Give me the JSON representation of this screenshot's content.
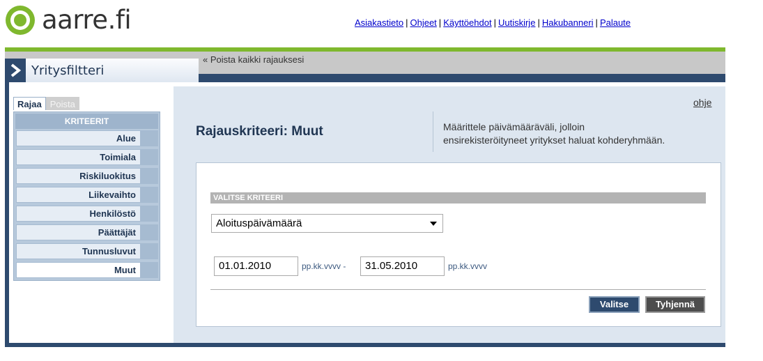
{
  "brand": {
    "name": "aarre.fi",
    "color": "#7fb82e"
  },
  "top_links": [
    "Asiakastieto",
    "Ohjeet",
    "Käyttöehdot",
    "Uutiskirje",
    "Hakubanneri",
    "Palaute"
  ],
  "top_link_separator": "|",
  "main_tab": {
    "title": "Yritysfiltteri",
    "icon": "chevron-right-icon"
  },
  "remove_all": "« Poista kaikki rajauksesi",
  "sidebar": {
    "tabs": [
      {
        "label": "Rajaa",
        "active": true
      },
      {
        "label": "Poista",
        "active": false
      }
    ],
    "header": "KRITEERIT",
    "items": [
      {
        "label": "Alue"
      },
      {
        "label": "Toimiala"
      },
      {
        "label": "Riskiluokitus"
      },
      {
        "label": "Liikevaihto"
      },
      {
        "label": "Henkilöstö"
      },
      {
        "label": "Päättäjät"
      },
      {
        "label": "Tunnusluvut"
      },
      {
        "label": "Muut",
        "selected": true
      }
    ]
  },
  "content": {
    "help": "ohje",
    "title": "Rajauskriteeri: Muut",
    "description_line1": "Määrittele päivämääräväli, jolloin",
    "description_line2": "ensirekisteröityneet yritykset haluat kohderyhmään.",
    "section_header": "VALITSE KRITEERI",
    "select_value": "Aloituspäivämäärä",
    "date_from": "01.01.2010",
    "date_to": "31.05.2010",
    "date_hint_1": "pp.kk.vvvv -",
    "date_hint_2": "pp.kk.vvvv",
    "buttons": {
      "select": "Valitse",
      "clear": "Tyhjennä"
    }
  },
  "colors": {
    "navy": "#2e4a6e",
    "light_blue": "#dde6f0",
    "link": "#0000cc"
  }
}
